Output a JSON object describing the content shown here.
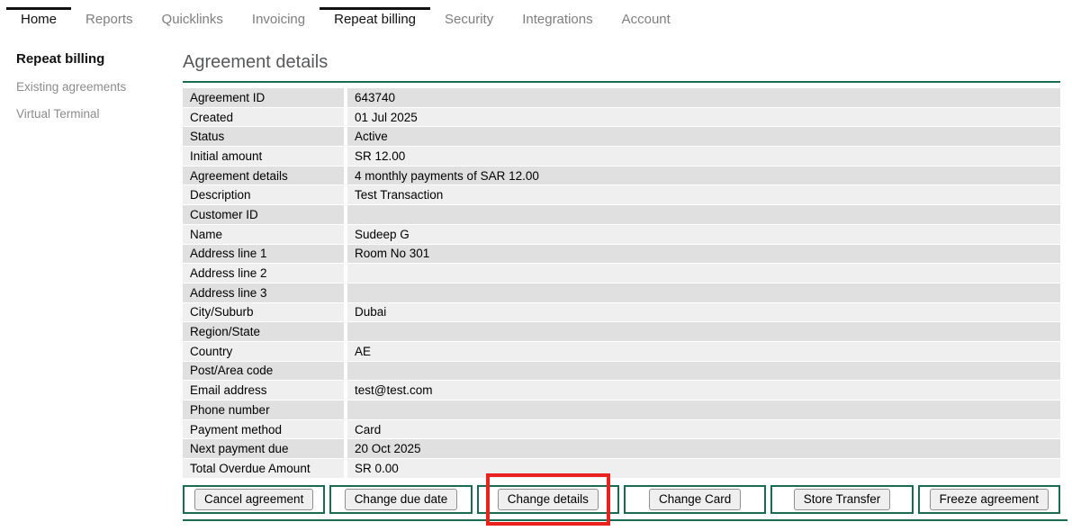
{
  "tabs": [
    {
      "label": "Home",
      "active": true
    },
    {
      "label": "Reports",
      "active": false
    },
    {
      "label": "Quicklinks",
      "active": false
    },
    {
      "label": "Invoicing",
      "active": false
    },
    {
      "label": "Repeat billing",
      "active": true
    },
    {
      "label": "Security",
      "active": false
    },
    {
      "label": "Integrations",
      "active": false
    },
    {
      "label": "Account",
      "active": false
    }
  ],
  "sidebar": {
    "title": "Repeat billing",
    "items": [
      {
        "label": "Existing agreements"
      },
      {
        "label": "Virtual Terminal"
      }
    ]
  },
  "main": {
    "title": "Agreement details"
  },
  "details": {
    "rows": [
      {
        "label": "Agreement ID",
        "value": "643740"
      },
      {
        "label": "Created",
        "value": "01 Jul 2025"
      },
      {
        "label": "Status",
        "value": "Active"
      },
      {
        "label": "Initial amount",
        "value": "SR 12.00"
      },
      {
        "label": "Agreement details",
        "value": "4 monthly payments of SAR 12.00"
      },
      {
        "label": "Description",
        "value": "Test Transaction"
      },
      {
        "label": "Customer ID",
        "value": ""
      },
      {
        "label": "Name",
        "value": "Sudeep G"
      },
      {
        "label": "Address line 1",
        "value": "Room No 301"
      },
      {
        "label": "Address line 2",
        "value": ""
      },
      {
        "label": "Address line 3",
        "value": ""
      },
      {
        "label": "City/Suburb",
        "value": "Dubai"
      },
      {
        "label": "Region/State",
        "value": ""
      },
      {
        "label": "Country",
        "value": "AE"
      },
      {
        "label": "Post/Area code",
        "value": ""
      },
      {
        "label": "Email address",
        "value": "test@test.com"
      },
      {
        "label": "Phone number",
        "value": ""
      },
      {
        "label": "Payment method",
        "value": "Card"
      },
      {
        "label": "Next payment due",
        "value": "20 Oct 2025"
      },
      {
        "label": "Total Overdue Amount",
        "value": "SR 0.00"
      }
    ]
  },
  "actions": {
    "buttons": [
      {
        "label": "Cancel agreement"
      },
      {
        "label": "Change due date"
      },
      {
        "label": "Change details",
        "highlighted": true
      },
      {
        "label": "Change Card"
      },
      {
        "label": "Store Transfer"
      },
      {
        "label": "Freeze agreement"
      }
    ]
  },
  "colors": {
    "accent_green": "#1a6b51",
    "highlight_red": "#e9221e",
    "row_dark": "#e0e0e0",
    "row_light": "#efefef",
    "active_tab": "#111111",
    "inactive_tab": "#7e7e7e"
  }
}
